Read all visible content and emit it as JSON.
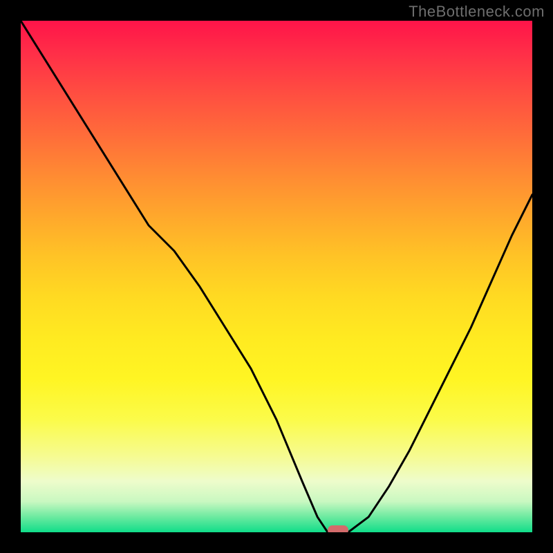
{
  "watermark": "TheBottleneck.com",
  "colors": {
    "background": "#000000",
    "marker": "#d36b6b",
    "curve": "#000000",
    "gradient_top": "#ff1449",
    "gradient_bottom": "#10dd8a"
  },
  "chart_data": {
    "type": "line",
    "title": "",
    "xlabel": "",
    "ylabel": "",
    "xlim": [
      0,
      100
    ],
    "ylim": [
      0,
      100
    ],
    "x": [
      0,
      5,
      10,
      15,
      20,
      25,
      30,
      35,
      40,
      45,
      50,
      55,
      58,
      60,
      62,
      64,
      68,
      72,
      76,
      80,
      84,
      88,
      92,
      96,
      100
    ],
    "values": [
      100,
      92,
      84,
      76,
      68,
      60,
      55,
      48,
      40,
      32,
      22,
      10,
      3,
      0,
      0,
      0,
      3,
      9,
      16,
      24,
      32,
      40,
      49,
      58,
      66
    ],
    "series": [
      {
        "name": "bottleneck-curve",
        "x_ref": "x",
        "y_ref": "values"
      }
    ],
    "marker": {
      "x": 62,
      "y": 0
    },
    "notes": "y represents bottleneck percentage; background gradient maps high (red, top) to low (green, bottom); curve dips to 0 near x≈60–64 with a marker at the minimum"
  }
}
